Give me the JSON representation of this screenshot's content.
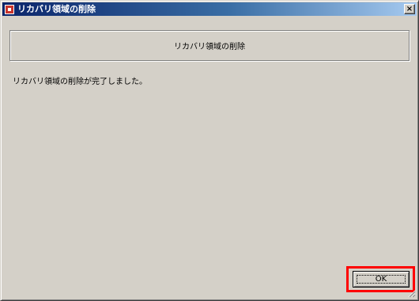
{
  "window": {
    "title": "リカバリ領域の削除",
    "close_symbol": "×",
    "icon": "app-icon"
  },
  "header": {
    "title": "リカバリ領域の削除"
  },
  "main": {
    "message": "リカバリ領域の削除が完了しました。"
  },
  "buttons": {
    "ok_label": "OK"
  },
  "colors": {
    "titlebar_start": "#0a246a",
    "titlebar_end": "#a6caf0",
    "face": "#d4d0c8",
    "highlight_box": "#ff0000"
  }
}
